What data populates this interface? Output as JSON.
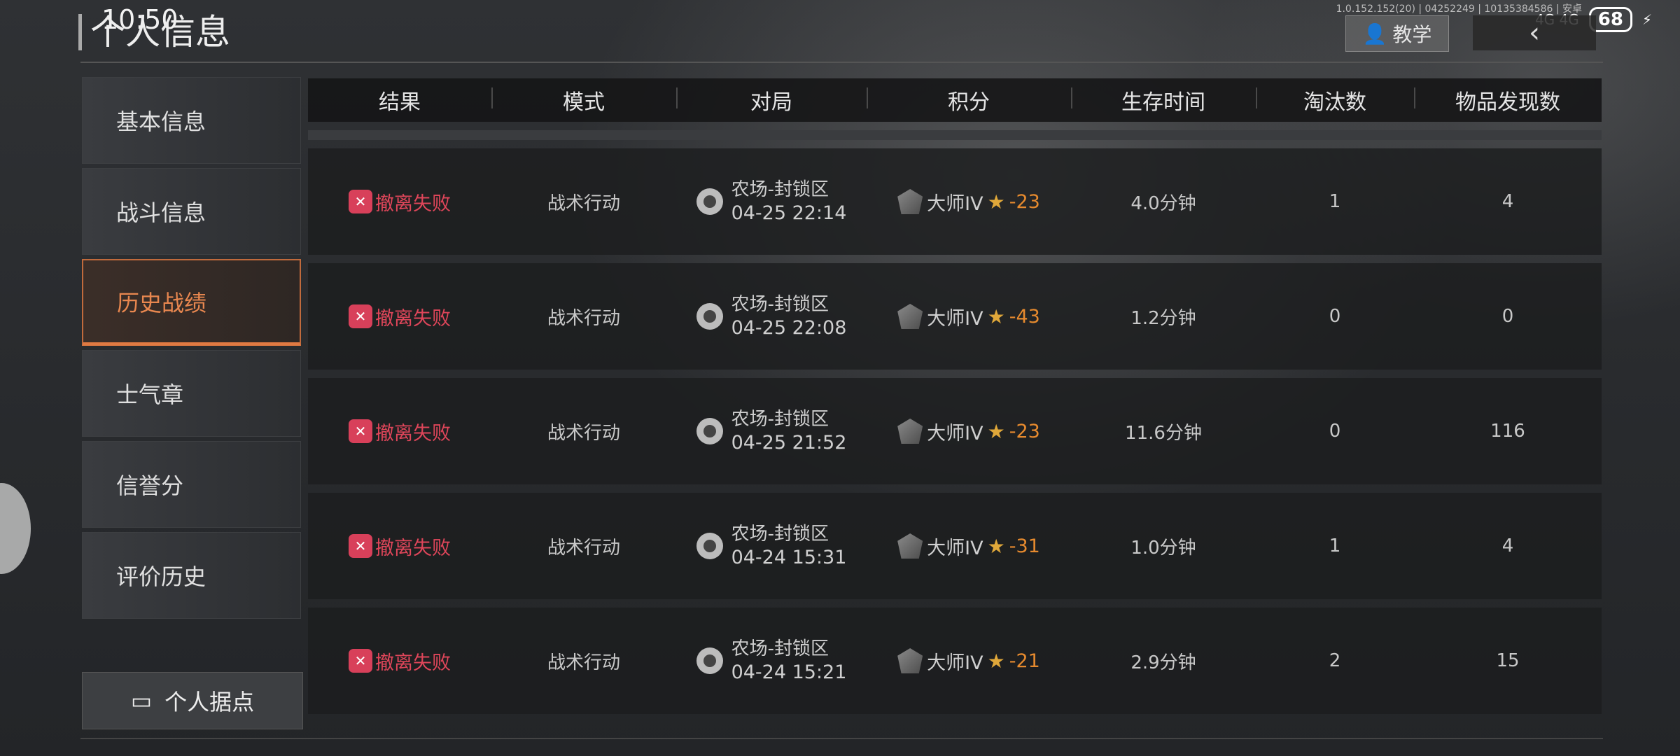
{
  "status_bar": {
    "time": "10:50",
    "battery": "68",
    "network": "4G 4G"
  },
  "version_text": "1.0.152.152(20) | 04252249 | 10135384586 | 安卓",
  "page_title": "个人信息",
  "teach_button": "教学",
  "sidebar": {
    "items": [
      {
        "label": "基本信息"
      },
      {
        "label": "战斗信息"
      },
      {
        "label": "历史战绩",
        "active": true
      },
      {
        "label": "士气章"
      },
      {
        "label": "信誉分"
      },
      {
        "label": "评价历史"
      }
    ],
    "base_button": "个人据点"
  },
  "table": {
    "headers": [
      "结果",
      "模式",
      "对局",
      "积分",
      "生存时间",
      "淘汰数",
      "物品发现数"
    ],
    "rows": [
      {
        "result": "撤离失败",
        "mode": "战术行动",
        "map": "农场-封锁区",
        "date": "04-25 22:14",
        "rank": "大师IV",
        "delta": "-23",
        "time": "4.0分钟",
        "kills": "1",
        "items": "4"
      },
      {
        "result": "撤离失败",
        "mode": "战术行动",
        "map": "农场-封锁区",
        "date": "04-25 22:08",
        "rank": "大师IV",
        "delta": "-43",
        "time": "1.2分钟",
        "kills": "0",
        "items": "0"
      },
      {
        "result": "撤离失败",
        "mode": "战术行动",
        "map": "农场-封锁区",
        "date": "04-25 21:52",
        "rank": "大师IV",
        "delta": "-23",
        "time": "11.6分钟",
        "kills": "0",
        "items": "116"
      },
      {
        "result": "撤离失败",
        "mode": "战术行动",
        "map": "农场-封锁区",
        "date": "04-24 15:31",
        "rank": "大师IV",
        "delta": "-31",
        "time": "1.0分钟",
        "kills": "1",
        "items": "4"
      },
      {
        "result": "撤离失败",
        "mode": "战术行动",
        "map": "农场-封锁区",
        "date": "04-24 15:21",
        "rank": "大师IV",
        "delta": "-21",
        "time": "2.9分钟",
        "kills": "2",
        "items": "15"
      }
    ]
  },
  "colors": {
    "accent": "#e07a42",
    "fail": "#e0465a",
    "delta": "#e68a2e"
  }
}
